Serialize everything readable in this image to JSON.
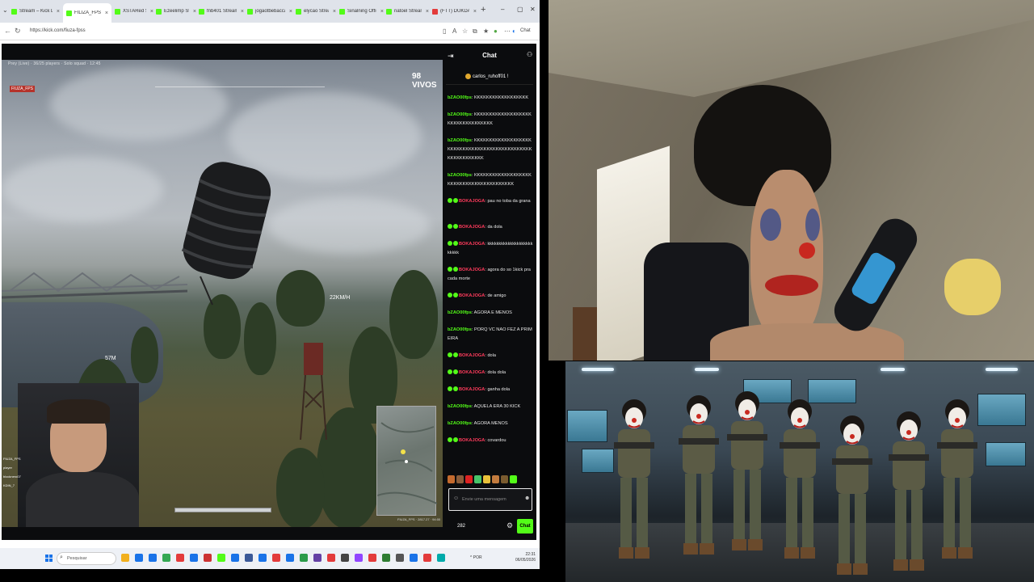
{
  "browser": {
    "tabs": [
      {
        "label": "Stream – Kick Dashb",
        "color": "#53fc18",
        "active": false
      },
      {
        "label": "FILIZA_FPSO N",
        "color": "#53fc18",
        "active": true
      },
      {
        "label": "XSTARed Stream",
        "color": "#53fc18",
        "active": false
      },
      {
        "label": "Ezeelimp Stream – •",
        "color": "#53fc18",
        "active": false
      },
      {
        "label": "fnb401 Stream",
        "color": "#53fc18",
        "active": false
      },
      {
        "label": "jogaotbebacca",
        "color": "#53fc18",
        "active": false
      },
      {
        "label": "elycao Stream",
        "color": "#53fc18",
        "active": false
      },
      {
        "label": "Sinalning Official",
        "color": "#53fc18",
        "active": false
      },
      {
        "label": "natoel Stream",
        "color": "#53fc18",
        "active": false
      },
      {
        "label": "(FTT) DUKDA CC",
        "color": "#e33b3b",
        "active": false
      }
    ],
    "new_tab_label": "+",
    "url": "https://kick.com/fiuza-fpss",
    "addr_chat_label": "Chat",
    "min_label": "–",
    "max_label": "▢",
    "close_label": "✕"
  },
  "stream": {
    "hud_top": "Prey (Live)  ·  36/25 players  ·  Solo squad  ·  12:45",
    "streamer_tag": "FIUZA_FPS",
    "viewers": "98 VIVOS",
    "altitude": "22KM/H",
    "speed": "57M",
    "minimap_label": "FIUZA_FPS · 2817.27 · 94:00",
    "team": [
      "FIUZA_FPS",
      "player",
      "blocknero07",
      "KDIN_7"
    ]
  },
  "chat": {
    "title": "Chat",
    "pinned_user": "carlos_ruhoff01 !",
    "messages": [
      {
        "user": "bZAO00fps",
        "color": "#53fc18",
        "text": "KKKKKKKKKKKKKKKKKK",
        "badges": 0
      },
      {
        "user": "bZAO00fps",
        "color": "#53fc18",
        "text": "KKKKKKKKKKKKKKKKKKKKKKKKKKKKKKKKKK",
        "badges": 0
      },
      {
        "user": "bZAO00fps",
        "color": "#53fc18",
        "text": "KKKKKKKKKKKKKKKKKKKKKKKKKKKKKKKKKKKKKKKKKKKKKKKKKKKKKKKKKKK",
        "badges": 0
      },
      {
        "user": "bZAO00fps",
        "color": "#53fc18",
        "text": "KKKKKKKKKKKKKKKKKKKKKKKKKKKKKKKKKKKKKKKKK",
        "badges": 0
      },
      {
        "user": "BOKAJOGA",
        "color": "#ff3b5c",
        "text": "pau no toba da grana",
        "badges": 2
      },
      {
        "user": "BOKAJOGA",
        "color": "#ff3b5c",
        "text": "da dola",
        "badges": 2
      },
      {
        "user": "BOKAJOGA",
        "color": "#ff3b5c",
        "text": "kkkkkkkkkkkkkkkkkkkkkkkkk",
        "badges": 2
      },
      {
        "user": "BOKAJOGA",
        "color": "#ff3b5c",
        "text": "agora do so 1kick pra cada morte",
        "badges": 2
      },
      {
        "user": "BOKAJOGA",
        "color": "#ff3b5c",
        "text": "de amigo",
        "badges": 2
      },
      {
        "user": "bZAO00fps",
        "color": "#53fc18",
        "text": "AGORA E MENOS",
        "badges": 0
      },
      {
        "user": "bZAO00fps",
        "color": "#53fc18",
        "text": "PORQ VC NAO FEZ A PRIMEIRA",
        "badges": 0
      },
      {
        "user": "BOKAJOGA",
        "color": "#ff3b5c",
        "text": "dola",
        "badges": 2
      },
      {
        "user": "BOKAJOGA",
        "color": "#ff3b5c",
        "text": "dola dola",
        "badges": 2
      },
      {
        "user": "BOKAJOGA",
        "color": "#ff3b5c",
        "text": "ganha dola",
        "badges": 2
      },
      {
        "user": "bZAO00fps",
        "color": "#53fc18",
        "text": "AQUELA ERA 30 KICK",
        "badges": 0
      },
      {
        "user": "bZAO00fps",
        "color": "#53fc18",
        "text": "AGORA MENOS",
        "badges": 0
      },
      {
        "user": "BOKAJOGA",
        "color": "#ff3b5c",
        "text": "covardou",
        "badges": 2
      }
    ],
    "input_placeholder": "Envie uma mensagem",
    "count": "282",
    "send_label": "Chat"
  },
  "taskbar": {
    "search_placeholder": "Pesquisar",
    "tray": "^  POR",
    "time": "22:31",
    "date": "06/05/2026"
  },
  "colors": {
    "kick_green": "#53fc18",
    "chat_bg": "#0b0c0e",
    "red_user": "#ff3b5c"
  }
}
